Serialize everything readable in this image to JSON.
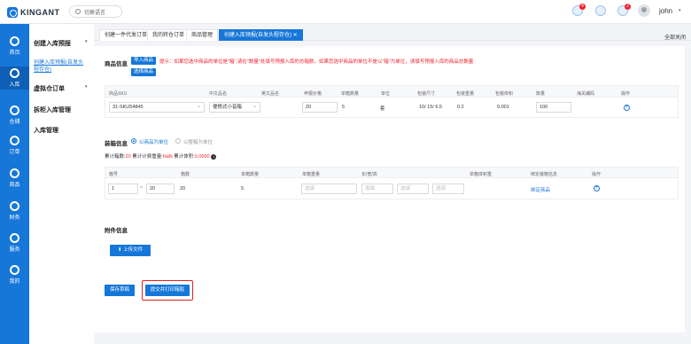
{
  "app": {
    "logo": "KINGANT",
    "language_label": "切换语言",
    "user": "john"
  },
  "header_badges": {
    "notifications": "4",
    "messages": "",
    "settings": "2"
  },
  "nav": [
    {
      "label": "首页",
      "icon": "palette-icon"
    },
    {
      "label": "入库",
      "icon": "inbound-icon"
    },
    {
      "label": "仓储",
      "icon": "warehouse-icon"
    },
    {
      "label": "订单",
      "icon": "order-icon"
    },
    {
      "label": "商品",
      "icon": "product-icon"
    },
    {
      "label": "财务",
      "icon": "finance-icon"
    },
    {
      "label": "服务",
      "icon": "service-icon"
    },
    {
      "label": "我的",
      "icon": "user-icon"
    }
  ],
  "submenu": {
    "create_inbound": "创建入库预报",
    "create_inbound_sub": "创建入库预报(自发头程存仓)",
    "virtual_order": "虚拟仓订单",
    "split_inbound": "拆柜入库管理",
    "inbound_manage": "入库管理"
  },
  "tabs": [
    "创建一件代发订单",
    "我的转仓订单",
    "商品管理",
    "创建入库预报(自发头程存仓)"
  ],
  "close_all": "全部关闭",
  "product_section": {
    "title": "商品信息",
    "import_button": "导入商品",
    "select_button": "选择商品",
    "warning": "提示：如果您选中商品的单位是\"箱\",请在\"数量\"处填写预报入库的总箱数，如果您选中商品的单位不是以\"箱\"为单位，请填写预报入库的商品总数量",
    "columns": [
      "商品SKU",
      "中文品名",
      "英文品名",
      "申报价格",
      "单箱数量",
      "单位",
      "包装尺寸",
      "包装重量",
      "包装体积",
      "数量",
      "海关编码",
      "操作"
    ],
    "row": {
      "sku": "31-SKU54845",
      "cn_name": "便携式小音箱",
      "en_name": "",
      "price": "20",
      "per_box": "5",
      "unit": "套",
      "size": "10/ 15/ 6.5",
      "weight": "0.2",
      "volume": "0.001",
      "qty": "100",
      "hs_code": ""
    }
  },
  "boxing_section": {
    "title": "装箱信息",
    "option_a": "以商品为单位",
    "option_b": "以整箱为单位",
    "summary_a": "累计箱数:",
    "summary_a_val": "20",
    "summary_b": "累计计费重量:",
    "summary_b_val": "NaN",
    "summary_c": "累计体积:",
    "summary_c_val": "0.0000",
    "columns": [
      "箱号",
      "箱数",
      "单箱数量",
      "单箱重量",
      "长/宽/高",
      "单箱体积重",
      "绑定装箱信息",
      "操作"
    ],
    "row": {
      "from": "1",
      "to": "20",
      "boxes": "20",
      "per_box": "5",
      "placeholder": "选填",
      "bind_link": "绑定商品"
    }
  },
  "attachment_section": {
    "title": "附件信息",
    "upload_button": "上传文件"
  },
  "actions": {
    "save_draft": "保存草稿",
    "submit_print": "提交并打印箱贴"
  },
  "colors": {
    "primary": "#1677d9",
    "warning": "#f5222d",
    "highlight_box": "#e02020"
  }
}
